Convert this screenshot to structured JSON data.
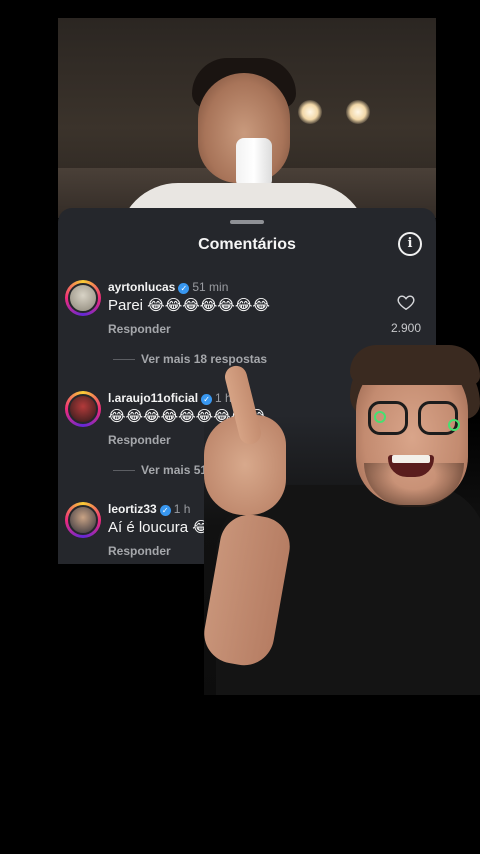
{
  "sheet": {
    "title": "Comentários",
    "info_label": "i"
  },
  "comments": [
    {
      "username": "ayrtonlucas",
      "time": "51 min",
      "text": "Parei 😂😂😂😂😂😂😂",
      "reply_label": "Responder",
      "more_replies": "Ver mais 18 respostas",
      "likes": "2.900"
    },
    {
      "username": "l.araujo11oficial",
      "time": "1 h",
      "text": "😂😂😂😂😂😂😂😂😂",
      "reply_label": "Responder",
      "more_replies": "Ver mais 51"
    },
    {
      "username": "leortiz33",
      "time": "1 h",
      "text": "Aí é loucura 😂",
      "text_tail": "😂😂",
      "reply_label": "Responder"
    }
  ],
  "icons": {
    "verified": "verified-badge-icon",
    "like": "heart-icon",
    "info": "info-icon"
  },
  "colors": {
    "sheet_bg": "#25272c",
    "verified": "#3897f0",
    "story_ring": "#ee2a7b"
  }
}
